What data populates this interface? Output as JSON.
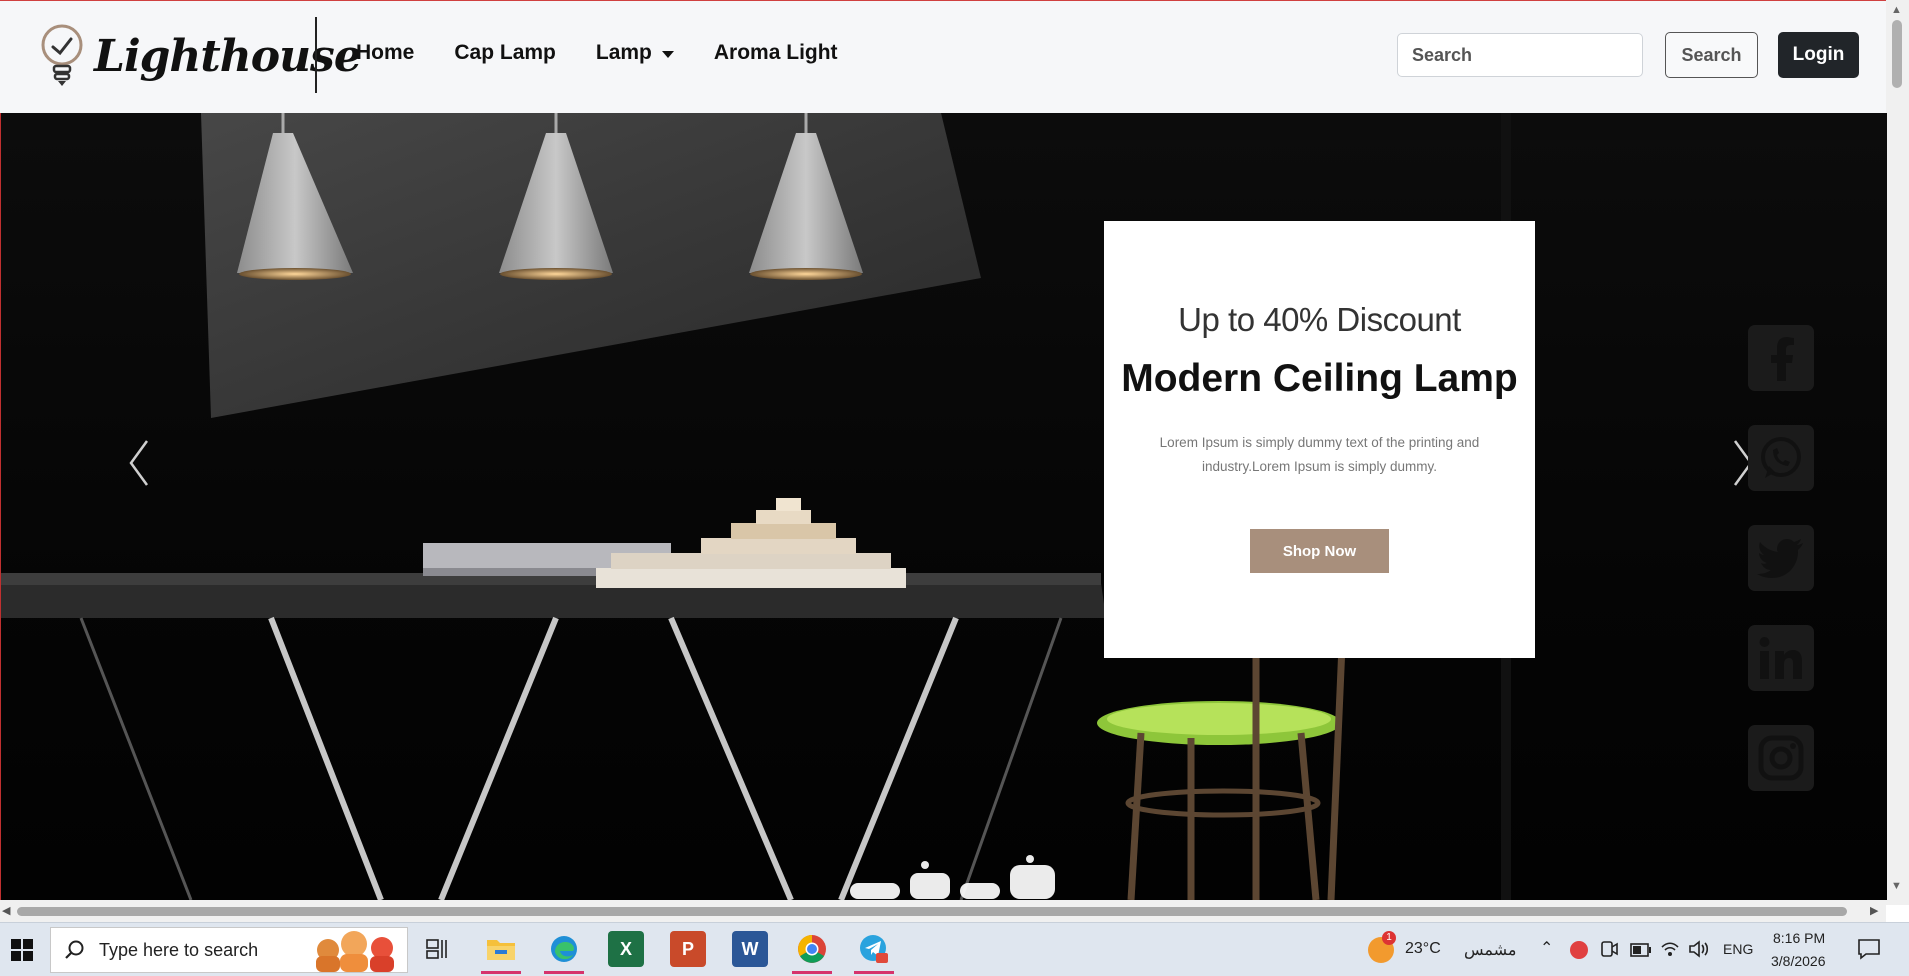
{
  "header": {
    "brand": "Lighthouse",
    "nav": [
      "Home",
      "Cap Lamp",
      "Lamp",
      "Aroma Light"
    ],
    "search_placeholder": "Search",
    "search_button": "Search",
    "login_button": "Login"
  },
  "hero": {
    "discount": "Up to 40% Discount",
    "title": "Modern Ceiling Lamp",
    "description": "Lorem Ipsum is simply dummy text of the printing and industry.Lorem Ipsum is simply dummy.",
    "cta": "Shop Now",
    "social": [
      "facebook-icon",
      "whatsapp-icon",
      "twitter-icon",
      "linkedin-icon",
      "instagram-icon"
    ]
  },
  "taskbar": {
    "search_placeholder": "Type here to search",
    "weather_temp": "23°C",
    "weather_label": "مشمس",
    "weather_badge": "1",
    "language": "ENG",
    "time": "8:16 PM",
    "date": "3/8/2026",
    "apps": [
      "task-view-icon",
      "file-explorer-icon",
      "edge-icon",
      "excel-icon",
      "powerpoint-icon",
      "word-icon",
      "chrome-icon",
      "telegram-icon"
    ]
  }
}
